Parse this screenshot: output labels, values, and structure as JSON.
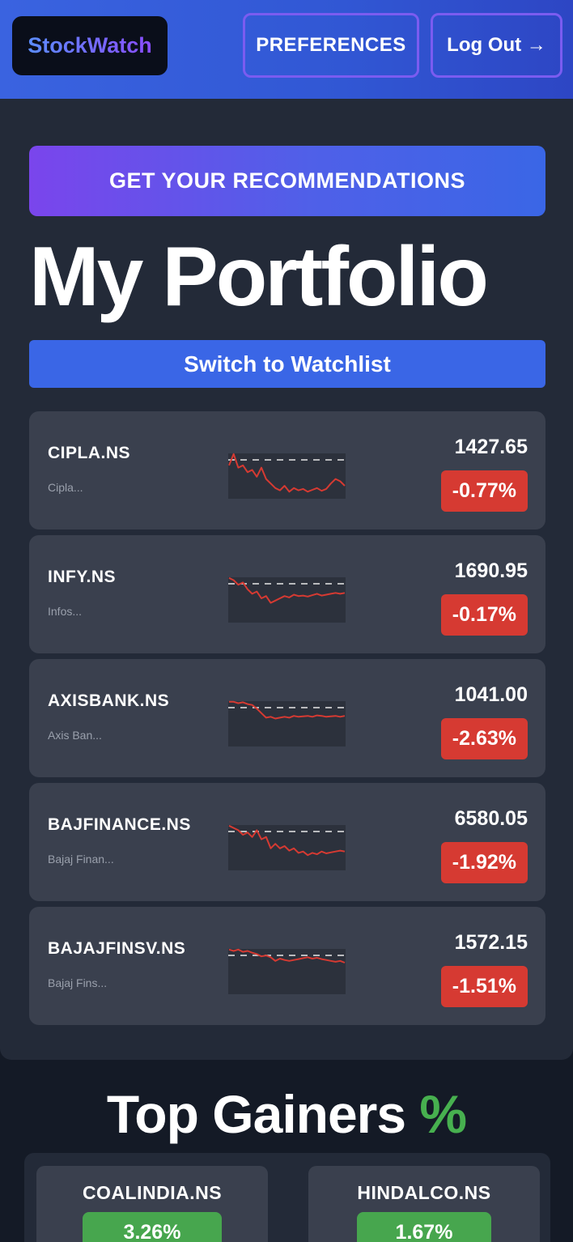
{
  "header": {
    "brand": "StockWatch",
    "preferences_label": "PREFERENCES",
    "logout_label": "Log Out →"
  },
  "main": {
    "recommendations_label": "GET YOUR RECOMMENDATIONS",
    "title": "My Portfolio",
    "switch_label": "Switch to Watchlist"
  },
  "colors": {
    "negative": "#d63a32",
    "positive": "#47a64e",
    "accent": "#3a66e6"
  },
  "stocks": [
    {
      "symbol": "CIPLA.NS",
      "name": "Cipla...",
      "price": "1427.65",
      "change": "-0.77%",
      "spark": [
        0.3,
        0.05,
        0.35,
        0.3,
        0.45,
        0.4,
        0.55,
        0.35,
        0.6,
        0.7,
        0.8,
        0.85,
        0.75,
        0.88,
        0.8,
        0.85,
        0.82,
        0.88,
        0.84,
        0.8,
        0.86,
        0.82,
        0.7,
        0.6,
        0.65,
        0.75
      ]
    },
    {
      "symbol": "INFY.NS",
      "name": "Infos...",
      "price": "1690.95",
      "change": "-0.17%",
      "spark": [
        0.05,
        0.1,
        0.2,
        0.15,
        0.3,
        0.4,
        0.35,
        0.5,
        0.45,
        0.6,
        0.55,
        0.5,
        0.45,
        0.48,
        0.42,
        0.45,
        0.44,
        0.46,
        0.43,
        0.4,
        0.44,
        0.42,
        0.4,
        0.38,
        0.4,
        0.38
      ]
    },
    {
      "symbol": "AXISBANK.NS",
      "name": "Axis Ban...",
      "price": "1041.00",
      "change": "-2.63%",
      "spark": [
        0.05,
        0.05,
        0.08,
        0.06,
        0.1,
        0.12,
        0.2,
        0.3,
        0.4,
        0.38,
        0.42,
        0.4,
        0.38,
        0.4,
        0.36,
        0.38,
        0.37,
        0.36,
        0.38,
        0.35,
        0.36,
        0.38,
        0.37,
        0.36,
        0.38,
        0.36
      ]
    },
    {
      "symbol": "BAJFINANCE.NS",
      "name": "Bajaj Finan...",
      "price": "6580.05",
      "change": "-1.92%",
      "spark": [
        0.05,
        0.1,
        0.15,
        0.25,
        0.2,
        0.3,
        0.15,
        0.35,
        0.3,
        0.55,
        0.45,
        0.55,
        0.5,
        0.6,
        0.55,
        0.65,
        0.62,
        0.7,
        0.65,
        0.68,
        0.62,
        0.66,
        0.64,
        0.62,
        0.6,
        0.62
      ]
    },
    {
      "symbol": "BAJAJFINSV.NS",
      "name": "Bajaj Fins...",
      "price": "1572.15",
      "change": "-1.51%",
      "spark": [
        0.05,
        0.08,
        0.05,
        0.1,
        0.08,
        0.12,
        0.15,
        0.2,
        0.18,
        0.22,
        0.3,
        0.25,
        0.28,
        0.3,
        0.28,
        0.26,
        0.24,
        0.22,
        0.25,
        0.23,
        0.26,
        0.28,
        0.3,
        0.32,
        0.3,
        0.34
      ]
    }
  ],
  "gainers": {
    "title": "Top Gainers",
    "title_suffix": "%",
    "items": [
      {
        "symbol": "COALINDIA.NS",
        "change": "3.26%"
      },
      {
        "symbol": "HINDALCO.NS",
        "change": "1.67%"
      }
    ]
  }
}
